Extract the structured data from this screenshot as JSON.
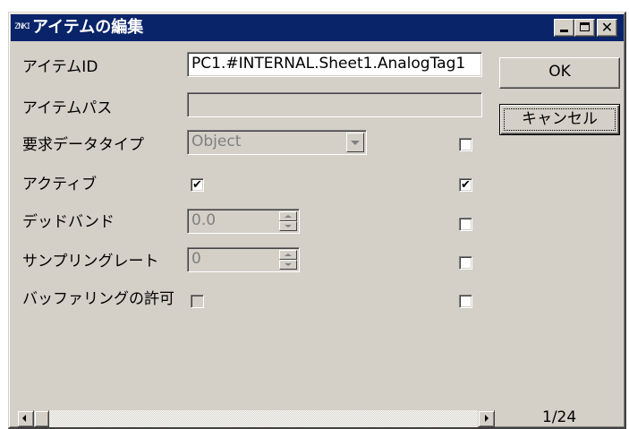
{
  "window": {
    "title": "アイテムの編集",
    "icon_text": "ZNKI",
    "controls": {
      "minimize": "",
      "maximize": "",
      "close": "✕"
    }
  },
  "labels": {
    "item_id": "アイテムID",
    "item_path": "アイテムパス",
    "requested_datatype": "要求データタイプ",
    "active": "アクティブ",
    "deadband": "デッドバンド",
    "sampling_rate": "サンプリングレート",
    "enable_buffering": "バッファリングの許可"
  },
  "fields": {
    "item_id_value": "PC1.#INTERNAL.Sheet1.AnalogTag1",
    "item_path_value": "",
    "datatype_value": "Object",
    "deadband_value": "0.0",
    "sampling_rate_value": "0"
  },
  "checkboxes": {
    "active": true,
    "enable_buffering": false,
    "apply_datatype": false,
    "apply_active": true,
    "apply_deadband": false,
    "apply_sampling_rate": false,
    "apply_buffering": false
  },
  "buttons": {
    "ok": "OK",
    "cancel": "キャンセル"
  },
  "pager": {
    "text": "1/24"
  }
}
